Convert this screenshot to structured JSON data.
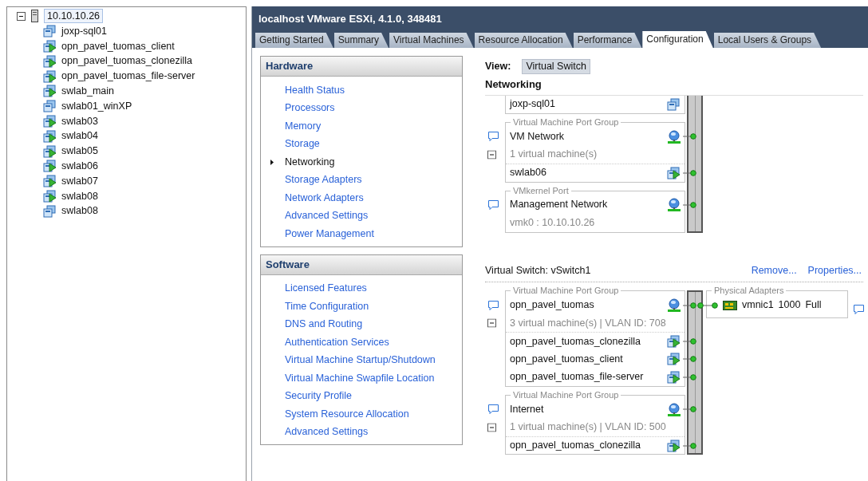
{
  "inventory": {
    "root": {
      "label": "10.10.10.26",
      "expanded": true,
      "selected": true,
      "children": [
        {
          "label": "joxp-sql01",
          "kind": "vm_off"
        },
        {
          "label": "opn_pavel_tuomas_client",
          "kind": "vm_on"
        },
        {
          "label": "opn_pavel_tuomas_clonezilla",
          "kind": "vm_on"
        },
        {
          "label": "opn_pavel_tuomas_file-server",
          "kind": "vm_on"
        },
        {
          "label": "swlab_main",
          "kind": "vm_on"
        },
        {
          "label": "swlab01_winXP",
          "kind": "vm_off"
        },
        {
          "label": "swlab03",
          "kind": "vm_on"
        },
        {
          "label": "swlab04",
          "kind": "vm_on"
        },
        {
          "label": "swlab05",
          "kind": "vm_on"
        },
        {
          "label": "swlab06",
          "kind": "vm_on"
        },
        {
          "label": "swlab07",
          "kind": "vm_on"
        },
        {
          "label": "swlab08",
          "kind": "vm_on"
        },
        {
          "label": "swlab08",
          "kind": "vm_off"
        }
      ]
    }
  },
  "header": {
    "title": "localhost VMware ESXi, 4.1.0, 348481"
  },
  "tabs": [
    {
      "label": "Getting Started",
      "selected": false
    },
    {
      "label": "Summary",
      "selected": false
    },
    {
      "label": "Virtual Machines",
      "selected": false
    },
    {
      "label": "Resource Allocation",
      "selected": false
    },
    {
      "label": "Performance",
      "selected": false
    },
    {
      "label": "Configuration",
      "selected": true
    },
    {
      "label": "Local Users & Groups",
      "selected": false
    }
  ],
  "config_sections": [
    {
      "title": "Hardware",
      "items": [
        {
          "label": "Health Status",
          "selected": false
        },
        {
          "label": "Processors",
          "selected": false
        },
        {
          "label": "Memory",
          "selected": false
        },
        {
          "label": "Storage",
          "selected": false
        },
        {
          "label": "Networking",
          "selected": true
        },
        {
          "label": "Storage Adapters",
          "selected": false
        },
        {
          "label": "Network Adapters",
          "selected": false
        },
        {
          "label": "Advanced Settings",
          "selected": false
        },
        {
          "label": "Power Management",
          "selected": false
        }
      ]
    },
    {
      "title": "Software",
      "items": [
        {
          "label": "Licensed Features",
          "selected": false
        },
        {
          "label": "Time Configuration",
          "selected": false
        },
        {
          "label": "DNS and Routing",
          "selected": false
        },
        {
          "label": "Authentication Services",
          "selected": false
        },
        {
          "label": "Virtual Machine Startup/Shutdown",
          "selected": false
        },
        {
          "label": "Virtual Machine Swapfile Location",
          "selected": false
        },
        {
          "label": "Security Profile",
          "selected": false
        },
        {
          "label": "System Resource Allocation",
          "selected": false
        },
        {
          "label": "Advanced Settings",
          "selected": false
        }
      ]
    }
  ],
  "networking": {
    "view_label": "View:",
    "view_value": "Virtual Switch",
    "heading": "Networking",
    "switches": [
      {
        "port_groups": [
          {
            "kind": "partial",
            "vms": [
              {
                "name": "joxp-sql01",
                "kind": "vm_off"
              }
            ]
          },
          {
            "kind": "vm_group",
            "type_label": "Virtual Machine Port Group",
            "name": "VM Network",
            "summary": "1 virtual machine(s)",
            "expanded": true,
            "vms": [
              {
                "name": "swlab06",
                "kind": "vm_on"
              }
            ]
          },
          {
            "kind": "vmkernel",
            "type_label": "VMkernel Port",
            "name": "Management Network",
            "detail": "vmk0 : 10.10.10.26"
          }
        ]
      },
      {
        "title": "Virtual Switch: vSwitch1",
        "actions": [
          "Remove...",
          "Properties..."
        ],
        "port_groups": [
          {
            "kind": "vm_group",
            "type_label": "Virtual Machine Port Group",
            "name": "opn_pavel_tuomas",
            "summary": "3 virtual machine(s) | VLAN ID: 708",
            "expanded": true,
            "vms": [
              {
                "name": "opn_pavel_tuomas_clonezilla",
                "kind": "vm_on"
              },
              {
                "name": "opn_pavel_tuomas_client",
                "kind": "vm_on"
              },
              {
                "name": "opn_pavel_tuomas_file-server",
                "kind": "vm_on"
              }
            ]
          },
          {
            "kind": "vm_group",
            "type_label": "Virtual Machine Port Group",
            "name": "Internet",
            "summary": "1 virtual machine(s) | VLAN ID: 500",
            "expanded": true,
            "vms": [
              {
                "name": "opn_pavel_tuomas_clonezilla",
                "kind": "vm_on"
              }
            ]
          }
        ],
        "adapters": {
          "label": "Physical Adapters",
          "items": [
            {
              "name": "vmnic1",
              "speed": "1000",
              "duplex": "Full"
            }
          ]
        }
      }
    ]
  }
}
